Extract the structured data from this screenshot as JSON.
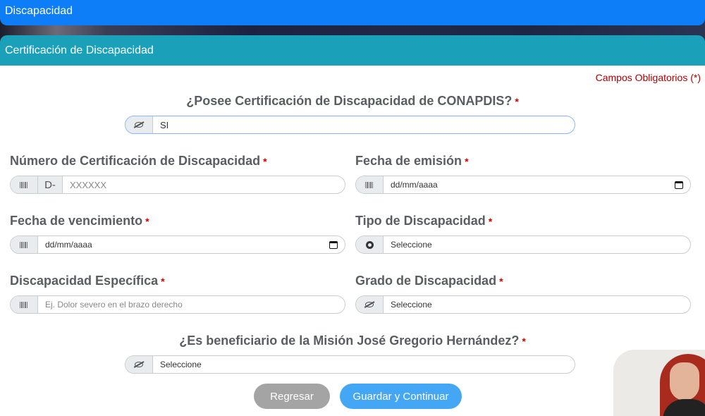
{
  "top_bar": {
    "title": "Discapacidad"
  },
  "panel": {
    "title": "Certificación de Discapacidad",
    "required_note": "Campos Obligatorios (*)"
  },
  "required_marker": "*",
  "q_certificacion": {
    "label": "¿Posee Certificación de Discapacidad de CONAPDIS?",
    "value": "SI"
  },
  "numero_cert": {
    "label": "Número de Certificación de Discapacidad",
    "prefix": "D-",
    "placeholder": "XXXXXX"
  },
  "fecha_emision": {
    "label": "Fecha de emisión",
    "value": "dd/mm/aaaa"
  },
  "fecha_vencimiento": {
    "label": "Fecha de vencimiento",
    "value": "dd/mm/aaaa"
  },
  "tipo": {
    "label": "Tipo de Discapacidad",
    "value": "Seleccione"
  },
  "especifica": {
    "label": "Discapacidad Específica",
    "placeholder": "Ej. Dolor severo en el brazo derecho"
  },
  "grado": {
    "label": "Grado de Discapacidad",
    "value": "Seleccione"
  },
  "q_mision": {
    "label": "¿Es beneficiario de la Misión José Gregorio Hernández?",
    "value": "Seleccione"
  },
  "buttons": {
    "back": "Regresar",
    "save": "Guardar y Continuar"
  },
  "icons": {
    "visibility": "eye-slash-icon",
    "barcode": "barcode-icon",
    "radio": "dot-circle-icon",
    "calendar": "calendar-icon"
  }
}
